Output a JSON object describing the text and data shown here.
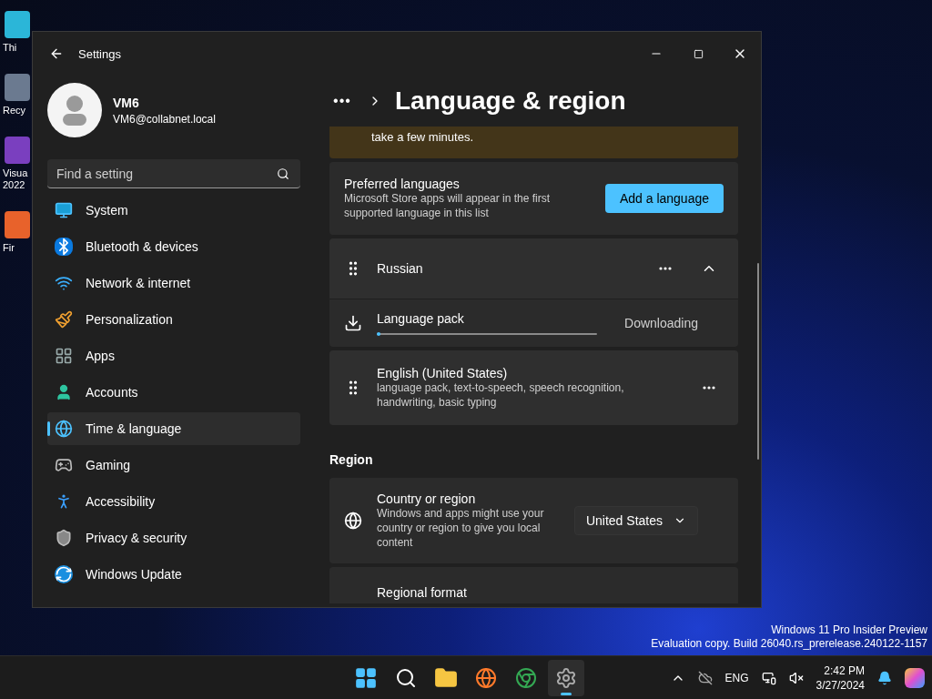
{
  "desktop_icons": [
    {
      "label": "Thi"
    },
    {
      "label": "Recy"
    },
    {
      "label": "Visua\n2022"
    },
    {
      "label": "Fir"
    }
  ],
  "window": {
    "title": "Settings"
  },
  "user": {
    "name": "VM6",
    "email": "VM6@collabnet.local"
  },
  "search": {
    "placeholder": "Find a setting"
  },
  "sidebar": {
    "items": [
      {
        "label": "System",
        "selected": false
      },
      {
        "label": "Bluetooth & devices",
        "selected": false
      },
      {
        "label": "Network & internet",
        "selected": false
      },
      {
        "label": "Personalization",
        "selected": false
      },
      {
        "label": "Apps",
        "selected": false
      },
      {
        "label": "Accounts",
        "selected": false
      },
      {
        "label": "Time & language",
        "selected": true
      },
      {
        "label": "Gaming",
        "selected": false
      },
      {
        "label": "Accessibility",
        "selected": false
      },
      {
        "label": "Privacy & security",
        "selected": false
      },
      {
        "label": "Windows Update",
        "selected": false
      }
    ]
  },
  "breadcrumb": {
    "overflow": "•••",
    "title": "Language & region"
  },
  "notice": {
    "text": "take a few minutes."
  },
  "preferred": {
    "title": "Preferred languages",
    "description": "Microsoft Store apps will appear in the first supported language in this list",
    "button": "Add a language"
  },
  "languages": [
    {
      "name": "Russian",
      "expanded": true,
      "pack": {
        "label": "Language pack",
        "level": 0.01,
        "status": "Downloading"
      }
    },
    {
      "name": "English (United States)",
      "features": "language pack, text-to-speech, speech recognition, handwriting, basic typing",
      "expanded": false
    }
  ],
  "region": {
    "heading": "Region",
    "settings": [
      {
        "kind": "dropdown",
        "title": "Country or region",
        "description": "Windows and apps might use your country or region to give you local content",
        "value": "United States"
      },
      {
        "kind": "dropdown",
        "title": "Regional format"
      }
    ]
  },
  "watermark": [
    "Windows 11 Pro Insider Preview",
    "Evaluation copy. Build 26040.rs_prerelease.240122-1157"
  ],
  "taskbar": {
    "apps": [
      {
        "active": false
      },
      {
        "active": false
      },
      {
        "active": false
      },
      {
        "active": false
      },
      {
        "active": false
      },
      {
        "active": true
      }
    ],
    "language": "ENG",
    "time": "2:42 PM",
    "date": "3/27/2024"
  }
}
